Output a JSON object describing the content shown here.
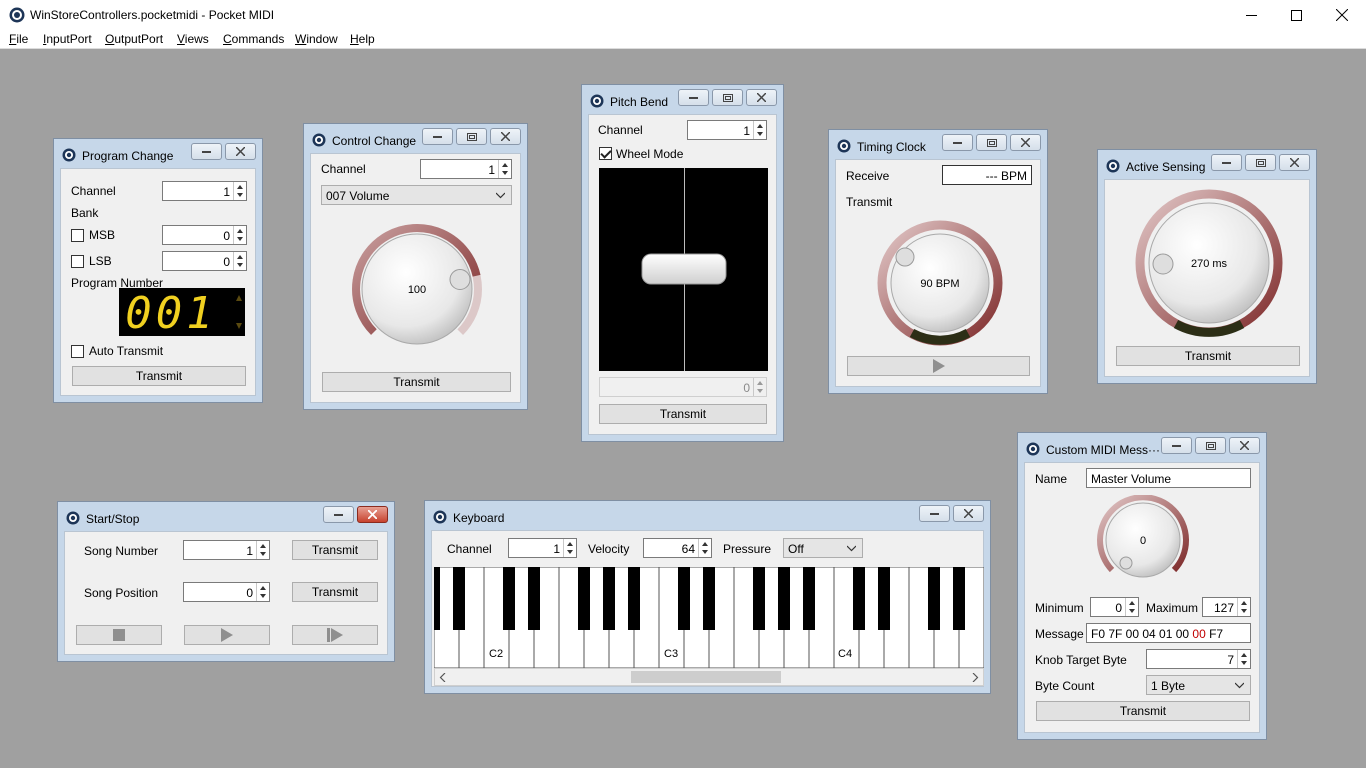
{
  "app": {
    "title": "WinStoreControllers.pocketmidi - Pocket MIDI",
    "menu": [
      "File",
      "InputPort",
      "OutputPort",
      "Views",
      "Commands",
      "Window",
      "Help"
    ],
    "menu_mnemonics": [
      "F",
      "I",
      "O",
      "V",
      "C",
      "W",
      "H"
    ]
  },
  "program_change": {
    "title": "Program Change",
    "channel_label": "Channel",
    "channel_value": "1",
    "bank_label": "Bank",
    "msb_label": "MSB",
    "msb_value": "0",
    "msb_checked": false,
    "lsb_label": "LSB",
    "lsb_value": "0",
    "lsb_checked": false,
    "program_number_label": "Program Number",
    "program_number_display": "001",
    "auto_transmit_label": "Auto Transmit",
    "auto_transmit_checked": false,
    "transmit_label": "Transmit"
  },
  "control_change": {
    "title": "Control Change",
    "channel_label": "Channel",
    "channel_value": "1",
    "controller_selected": "007 Volume",
    "knob_value": "100",
    "knob_fraction": 0.787,
    "transmit_label": "Transmit"
  },
  "pitch_bend": {
    "title": "Pitch Bend",
    "channel_label": "Channel",
    "channel_value": "1",
    "wheel_mode_label": "Wheel Mode",
    "wheel_mode_checked": true,
    "value": "0",
    "transmit_label": "Transmit"
  },
  "timing_clock": {
    "title": "Timing Clock",
    "receive_label": "Receive",
    "receive_value": "--- BPM",
    "transmit_label": "Transmit",
    "knob_value": "90 BPM",
    "play_icon": "play-icon"
  },
  "active_sensing": {
    "title": "Active Sensing",
    "knob_value": "270 ms",
    "transmit_label": "Transmit"
  },
  "start_stop": {
    "title": "Start/Stop",
    "song_number_label": "Song Number",
    "song_number_value": "1",
    "song_position_label": "Song Position",
    "song_position_value": "0",
    "transmit_label": "Transmit",
    "transport_icons": [
      "stop-icon",
      "play-icon",
      "continue-icon"
    ]
  },
  "keyboard": {
    "title": "Keyboard",
    "channel_label": "Channel",
    "channel_value": "1",
    "velocity_label": "Velocity",
    "velocity_value": "64",
    "pressure_label": "Pressure",
    "pressure_selected": "Off",
    "octave_labels": [
      "C2",
      "C3",
      "C4"
    ]
  },
  "custom_midi": {
    "title": "Custom MIDI Mess···",
    "name_label": "Name",
    "name_value": "Master Volume",
    "knob_value": "0",
    "minimum_label": "Minimum",
    "minimum_value": "0",
    "maximum_label": "Maximum",
    "maximum_value": "127",
    "message_label": "Message",
    "message_prefix": "F0 7F 00 04 01 00 ",
    "message_highlight": "00",
    "message_suffix": " F7",
    "knob_target_label": "Knob Target Byte",
    "knob_target_value": "7",
    "byte_count_label": "Byte Count",
    "byte_count_selected": "1 Byte",
    "transmit_label": "Transmit"
  },
  "colors": {
    "workspace": "#a0a0a0",
    "child_frame": "#c6d7e9",
    "knob_arc": "#8b2a2a",
    "led": "#f0d020",
    "message_highlight": "#c00000"
  }
}
